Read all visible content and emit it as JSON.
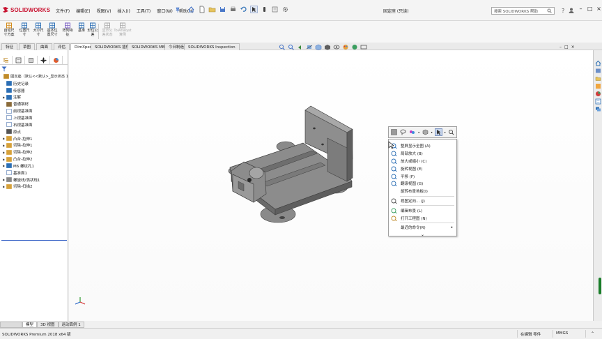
{
  "app": {
    "logo_text": "SOLIDWORKS",
    "window_title": "固定座 (只读)"
  },
  "menu": [
    "文件(F)",
    "编辑(E)",
    "视图(V)",
    "插入(I)",
    "工具(T)",
    "窗口(W)",
    "帮助(H)"
  ],
  "search": {
    "placeholder": "搜索 SOLIDWORKS 帮助"
  },
  "commands": [
    {
      "label": "自动尺\n寸方案",
      "icon": "auto-dimension-icon",
      "enabled": true
    },
    {
      "label": "位置尺\n寸",
      "icon": "location-dimension-icon",
      "enabled": true
    },
    {
      "label": "大小尺\n寸",
      "icon": "size-dimension-icon",
      "enabled": true
    },
    {
      "label": "基本位\n置尺寸",
      "icon": "basic-location-dimension-icon",
      "enabled": true
    },
    {
      "label": "阵列特\n征",
      "icon": "pattern-feature-icon",
      "enabled": true
    },
    {
      "label": "基准",
      "icon": "datum-icon",
      "enabled": true
    },
    {
      "label": "形位公\n差",
      "icon": "geometric-tolerance-icon",
      "enabled": true
    },
    {
      "label": "显示公\n差状态",
      "icon": "show-tolerance-status-icon",
      "enabled": false
    },
    {
      "label": "TolAnalyst\n算例",
      "icon": "tolanalyst-icon",
      "enabled": false
    }
  ],
  "tabs": [
    "特征",
    "草图",
    "曲面",
    "评估",
    "DimXpert",
    "SOLIDWORKS 插件",
    "SOLIDWORKS MBD",
    "今日制造",
    "SOLIDWORKS Inspection"
  ],
  "active_tab_index": 4,
  "tree": [
    {
      "label": "固定座（默认<<默认>_显示状态 1",
      "icon": "part-icon",
      "expand": false,
      "level": 0
    },
    {
      "label": "历史记录",
      "icon": "history-icon",
      "expand": false,
      "level": 1
    },
    {
      "label": "传感器",
      "icon": "sensor-icon",
      "expand": false,
      "level": 1
    },
    {
      "label": "注解",
      "icon": "annotation-icon",
      "expand": true,
      "level": 1
    },
    {
      "label": "普通钢材",
      "icon": "material-icon",
      "expand": false,
      "level": 1
    },
    {
      "label": "前视基准面",
      "icon": "plane-icon",
      "expand": false,
      "level": 1
    },
    {
      "label": "上视基准面",
      "icon": "plane-icon",
      "expand": false,
      "level": 1
    },
    {
      "label": "右视基准面",
      "icon": "plane-icon",
      "expand": false,
      "level": 1
    },
    {
      "label": "原点",
      "icon": "origin-icon",
      "expand": false,
      "level": 1
    },
    {
      "label": "凸台-拉伸1",
      "icon": "boss-extrude-icon",
      "expand": true,
      "level": 1
    },
    {
      "label": "切除-拉伸1",
      "icon": "cut-extrude-icon",
      "expand": true,
      "level": 1
    },
    {
      "label": "切除-拉伸2",
      "icon": "cut-extrude-icon",
      "expand": true,
      "level": 1
    },
    {
      "label": "凸台-拉伸2",
      "icon": "boss-extrude-icon",
      "expand": true,
      "level": 1
    },
    {
      "label": "M6 螺纹孔1",
      "icon": "hole-wizard-icon",
      "expand": true,
      "level": 1
    },
    {
      "label": "基准面1",
      "icon": "plane-icon",
      "expand": false,
      "level": 1
    },
    {
      "label": "螺旋线/涡状线1",
      "icon": "helix-icon",
      "expand": true,
      "level": 1
    },
    {
      "label": "切除-扫描2",
      "icon": "swept-cut-icon",
      "expand": true,
      "level": 1
    }
  ],
  "bottom_tabs": [
    "模型",
    "3D 视图",
    "运动算例 1"
  ],
  "context_menu": {
    "items": [
      {
        "label": "整屏显示全图 (A)",
        "icon": "zoom-to-fit-icon"
      },
      {
        "label": "局部放大 (B)",
        "icon": "zoom-to-area-icon"
      },
      {
        "label": "放大或缩小 (C)",
        "icon": "zoom-in-out-icon"
      },
      {
        "label": "旋转视图 (E)",
        "icon": "rotate-view-icon"
      },
      {
        "label": "平移 (F)",
        "icon": "pan-icon"
      },
      {
        "label": "翻滚视图 (G)",
        "icon": "roll-view-icon"
      },
      {
        "label": "旋转布景地板(I)",
        "icon": ""
      },
      {
        "label": "视图定向... (J)",
        "icon": "view-orientation-icon"
      },
      {
        "label": "编辑布景 (L)",
        "icon": "edit-scene-icon"
      },
      {
        "label": "打开工程图 (N)",
        "icon": "open-drawing-icon"
      },
      {
        "label": "最近的命令(R)",
        "icon": "",
        "submenu": true
      }
    ],
    "more": "⌄"
  },
  "status": {
    "product": "SOLIDWORKS Premium 2018 x64 版",
    "mode": "在编辑 零件",
    "units": "MMGS"
  },
  "colors": {
    "brand": "#c8102e",
    "part_face": "#8c8c8c",
    "part_dark": "#5e5e5e",
    "part_light": "#a8a8a8",
    "selection": "#c8d6ec"
  }
}
